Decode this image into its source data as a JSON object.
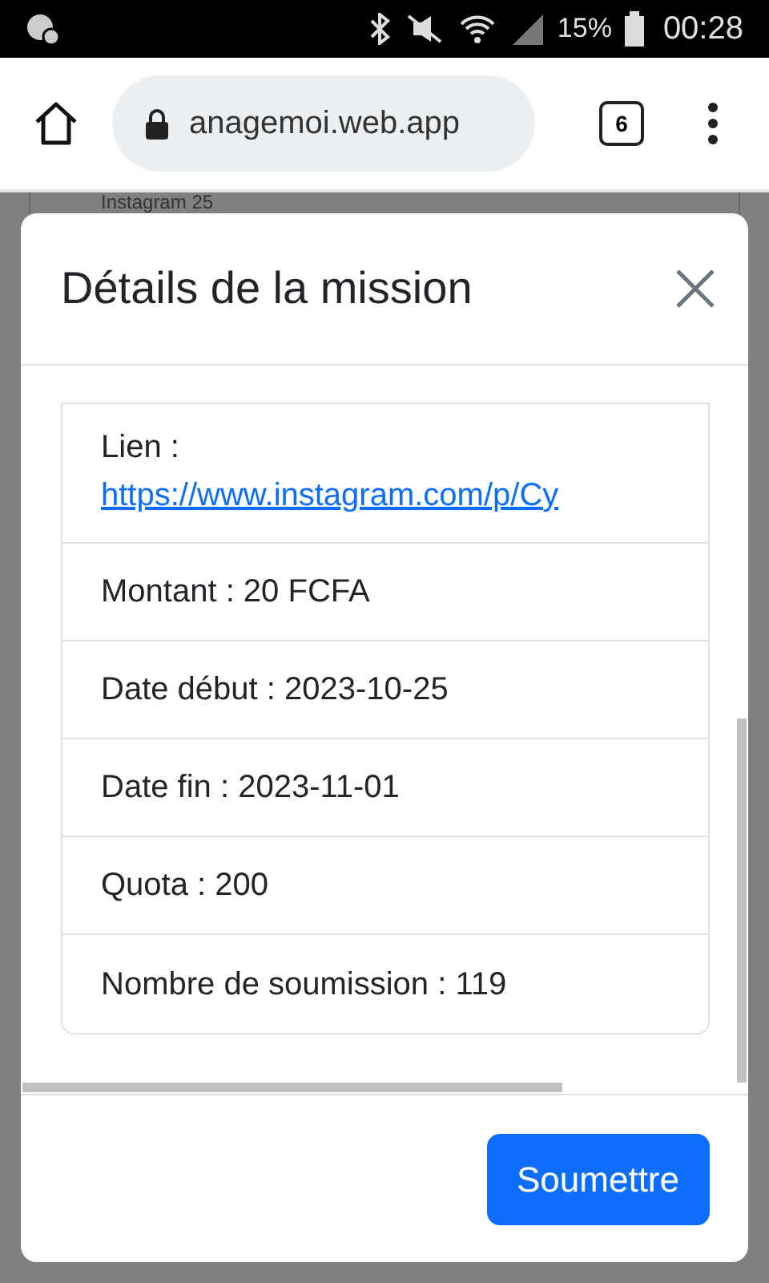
{
  "status_bar": {
    "battery": "15%",
    "time": "00:28"
  },
  "browser": {
    "url": "anagemoi.web.app",
    "tab_count": "6"
  },
  "background_page": {
    "heading": "Instagram 25"
  },
  "modal": {
    "title": "Détails de la mission",
    "rows": [
      {
        "kind": "link",
        "label": "Lien :",
        "link": "https://www.instagram.com/p/Cy"
      },
      {
        "kind": "text",
        "text": "Montant : 20 FCFA"
      },
      {
        "kind": "text",
        "text": "Date début : 2023-10-25"
      },
      {
        "kind": "text",
        "text": "Date fin : 2023-11-01"
      },
      {
        "kind": "text",
        "text": "Quota : 200"
      },
      {
        "kind": "text",
        "text": "Nombre de soumission : 119"
      }
    ],
    "submit_button": "Soumettre"
  }
}
